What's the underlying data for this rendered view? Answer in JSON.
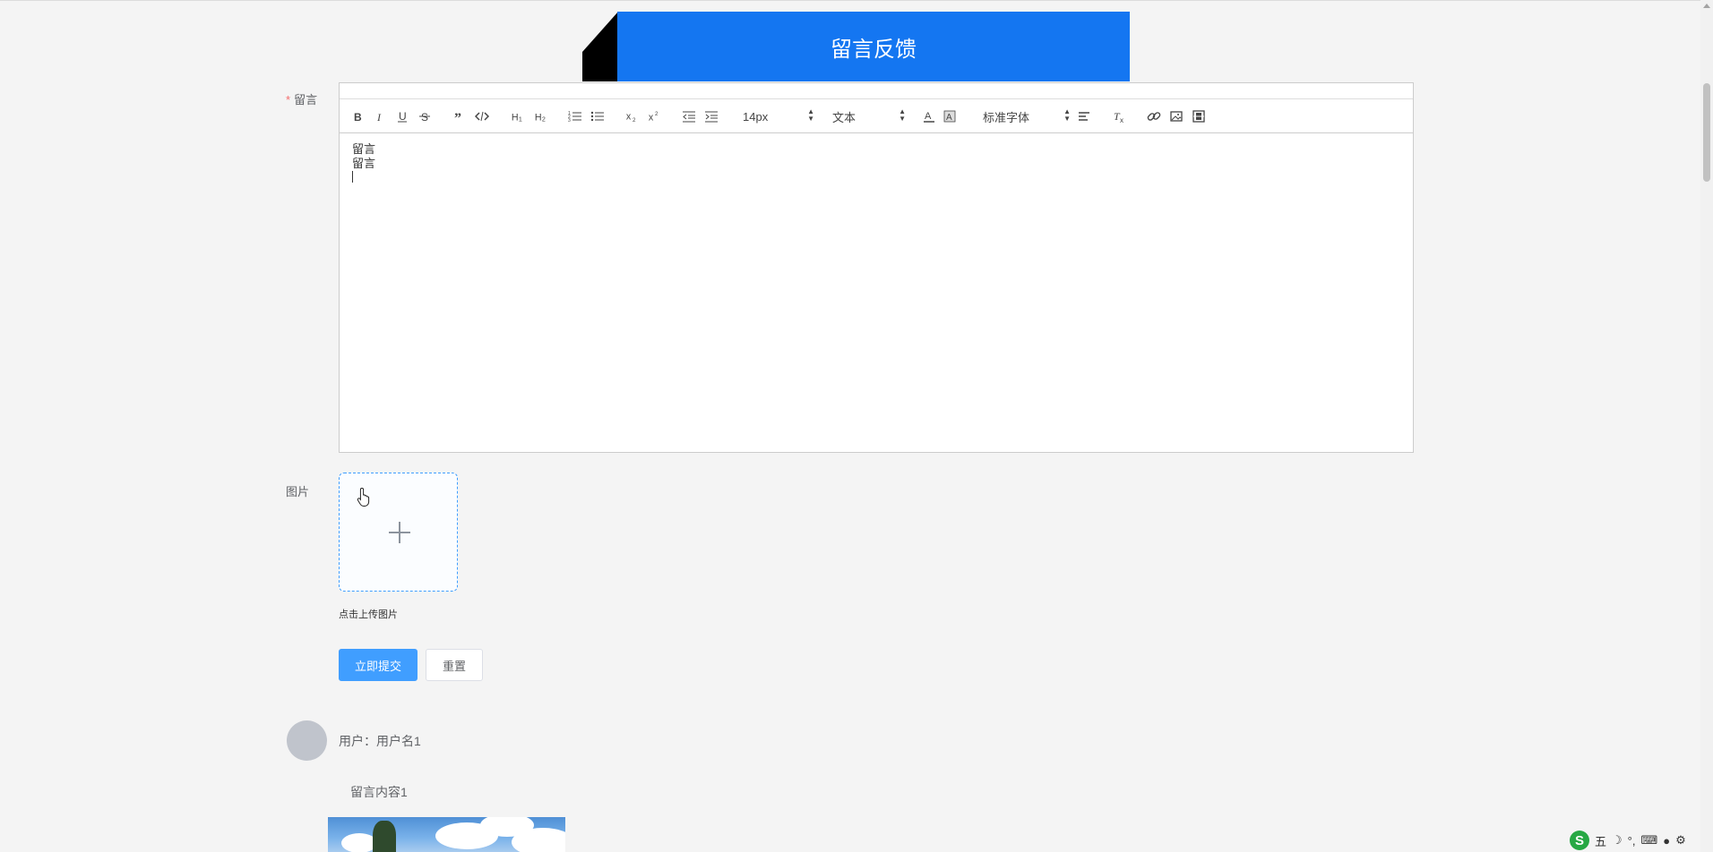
{
  "banner": {
    "title": "留言反馈"
  },
  "form": {
    "message_label": "留言",
    "required_mark": "*",
    "image_label": "图片",
    "upload_tip": "点击上传图片",
    "submit_label": "立即提交",
    "reset_label": "重置"
  },
  "editor": {
    "size_value": "14px",
    "header_value": "文本",
    "font_value": "标准字体",
    "content_lines": [
      "留言",
      "留言"
    ],
    "tool_icons": [
      "bold-icon",
      "italic-icon",
      "underline-icon",
      "strike-icon",
      "blockquote-icon",
      "code-block-icon",
      "h1-icon",
      "h2-icon",
      "ordered-list-icon",
      "bullet-list-icon",
      "subscript-icon",
      "superscript-icon",
      "outdent-icon",
      "indent-icon",
      "font-color-icon",
      "background-color-icon",
      "align-icon",
      "clean-format-icon",
      "link-icon",
      "image-icon",
      "video-icon"
    ]
  },
  "comments": [
    {
      "user": "用户：用户名1",
      "content": "留言内容1"
    }
  ],
  "ime": {
    "mode": "五",
    "symbols": "°,"
  },
  "colors": {
    "accent": "#1476f1",
    "primary_button": "#409eff",
    "required": "#f56c6c"
  }
}
